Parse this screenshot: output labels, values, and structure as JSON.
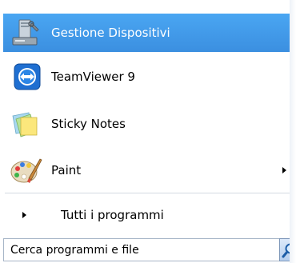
{
  "start_menu": {
    "pinned_items": [
      {
        "label": "Gestione Dispositivi",
        "icon": "device-manager-icon",
        "selected": true
      },
      {
        "label": "TeamViewer 9",
        "icon": "teamviewer-icon",
        "selected": false
      },
      {
        "label": "Sticky Notes",
        "icon": "sticky-notes-icon",
        "selected": false
      },
      {
        "label": "Paint",
        "icon": "paint-palette-icon",
        "selected": false,
        "has_submenu": true
      }
    ],
    "all_programs_label": "Tutti i programmi",
    "search": {
      "placeholder": "Cerca programmi e file",
      "value": ""
    }
  },
  "colors": {
    "selection": "#3b8fe0",
    "selected_text": "#ffffff",
    "text": "#000000"
  }
}
